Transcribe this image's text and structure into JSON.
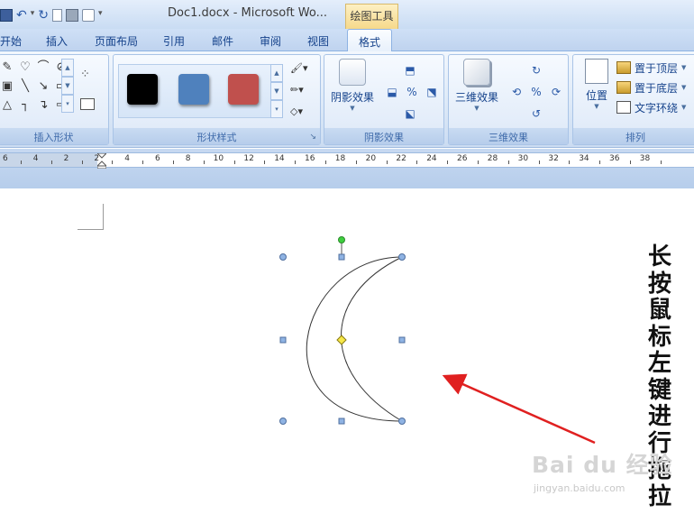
{
  "window": {
    "doc_title": "Doc1.docx - Microsoft Wo...",
    "context_tool_label": "绘图工具"
  },
  "tabs": [
    {
      "label": "开始"
    },
    {
      "label": "插入"
    },
    {
      "label": "页面布局"
    },
    {
      "label": "引用"
    },
    {
      "label": "邮件"
    },
    {
      "label": "审阅"
    },
    {
      "label": "视图"
    },
    {
      "label": "格式",
      "active": true
    }
  ],
  "ribbon": {
    "insert_shapes": {
      "label": "插入形状"
    },
    "shape_styles": {
      "label": "形状样式",
      "swatches": [
        {
          "name": "black-style",
          "color": "#000000"
        },
        {
          "name": "blue-style",
          "color": "#4f81bd"
        },
        {
          "name": "red-style",
          "color": "#c0504d"
        }
      ]
    },
    "shadow_effects": {
      "label": "阴影效果",
      "button_label": "阴影效果"
    },
    "three_d_effects": {
      "label": "三维效果",
      "button_label": "三维效果"
    },
    "arrange": {
      "label": "排列",
      "position_label": "位置",
      "bring_to_front": "置于顶层",
      "send_to_back": "置于底层",
      "text_wrap": "文字环绕"
    }
  },
  "ruler": {
    "ticks": [
      "6",
      "4",
      "2",
      "2",
      "4",
      "6",
      "8",
      "10",
      "12",
      "14",
      "16",
      "18",
      "20",
      "22",
      "24",
      "26",
      "28",
      "30",
      "32",
      "34",
      "36",
      "38"
    ]
  },
  "document": {
    "shape": "moon",
    "annotation_text": "长按鼠标左键进行拖拉",
    "annotation_arrow_color": "#e02020",
    "watermark": "Bai du 经验",
    "watermark_url": "jingyan.baidu.com"
  }
}
